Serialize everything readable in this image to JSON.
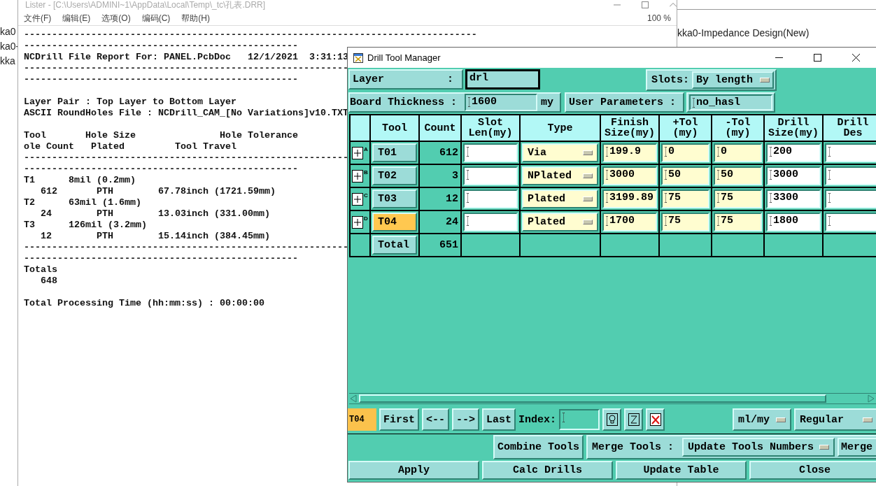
{
  "background": {
    "left_labels": [
      "ka0",
      "ka0-",
      "kka"
    ],
    "right_labels": [
      "kka0-Impedance Design(New)"
    ]
  },
  "lister": {
    "title": "Lister - [C:\\Users\\ADMINI~1\\AppData\\Local\\Temp\\_tc\\孔表.DRR]",
    "menu": [
      "文件(F)",
      "编辑(E)",
      "选项(O)",
      "编码(C)",
      "帮助(H)"
    ],
    "zoom": "100 %",
    "blocks": [
      [
        "---------------------------------------------------------------------------------",
        "-------------------------------------------------",
        "NCDrill File Report For: PANEL.PcbDoc   12/1/2021  3:31:13",
        "----------------------------------------------------------",
        "-------------------------------------------------"
      ],
      [
        "Layer Pair : Top Layer to Bottom Layer",
        "ASCII RoundHoles File : NCDrill_CAM_[No Variations]v10.TXT"
      ],
      [
        "Tool       Hole Size               Hole Tolerance",
        "ole Count   Plated         Tool Travel",
        "----------------------------------------------------------",
        "-------------------------------------------------",
        "T1      8mil (0.2mm)",
        "   612       PTH        67.78inch (1721.59mm)",
        "T2      63mil (1.6mm)",
        "   24        PTH        13.03inch (331.00mm)",
        "T3      126mil (3.2mm)",
        "   12        PTH        15.14inch (384.45mm)",
        "----------------------------------------------------------",
        "-------------------------------------------------",
        "Totals",
        "   648"
      ],
      [
        "Total Processing Time (hh:mm:ss) : 00:00:00"
      ]
    ]
  },
  "drill_manager": {
    "title": "Drill Tool Manager",
    "layer": {
      "label": "Layer          :",
      "value": "drl"
    },
    "slots": {
      "label": "Slots:",
      "value": "By length"
    },
    "board_thickness": {
      "label": "Board Thickness :",
      "value": "1600",
      "unit": "my"
    },
    "user_parameters": {
      "label": "User Parameters :",
      "value": "no_hasl"
    },
    "columns": [
      "Tool",
      "Count",
      "Slot\nLen(my)",
      "Type",
      "Finish\nSize(my)",
      "+Tol\n(my)",
      "-Tol\n(my)",
      "Drill\nSize(my)",
      "Drill\nDes"
    ],
    "rows": [
      {
        "letter": "A",
        "tool": "T01",
        "selected": false,
        "count": "612",
        "type": "Via",
        "finish_size": "199.9",
        "plus_tol": "0",
        "minus_tol": "0",
        "drill_size": "200"
      },
      {
        "letter": "B",
        "tool": "T02",
        "selected": false,
        "count": "3",
        "type": "NPlated",
        "finish_size": "3000",
        "plus_tol": "50",
        "minus_tol": "50",
        "drill_size": "3000"
      },
      {
        "letter": "C",
        "tool": "T03",
        "selected": false,
        "count": "12",
        "type": "Plated",
        "finish_size": "3199.89",
        "plus_tol": "75",
        "minus_tol": "75",
        "drill_size": "3300"
      },
      {
        "letter": "D",
        "tool": "T04",
        "selected": true,
        "count": "24",
        "type": "Plated",
        "finish_size": "1700",
        "plus_tol": "75",
        "minus_tol": "75",
        "drill_size": "1800"
      }
    ],
    "total": {
      "label": "Total",
      "count": "651"
    },
    "nav": {
      "current_tool": "T04",
      "buttons": [
        "First",
        "<--",
        "-->",
        "Last"
      ],
      "index_label": "Index:",
      "units": "ml/my",
      "mode": "Regular"
    },
    "merge": {
      "combine": "Combine Tools",
      "label": "Merge Tools :",
      "option": "Update Tools Numbers",
      "button": "Merge"
    },
    "actions": [
      "Apply",
      "Calc Drills",
      "Update Table",
      "Close"
    ]
  }
}
